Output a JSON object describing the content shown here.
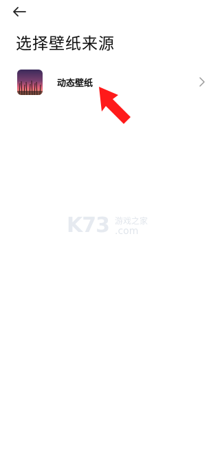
{
  "header": {
    "back_icon": "arrow-left-icon"
  },
  "page_title": "选择壁纸来源",
  "sources": [
    {
      "label": "动态壁纸",
      "thumbnail": "sunset-grass-thumbnail",
      "chevron_icon": "chevron-right-icon"
    }
  ],
  "annotation": {
    "arrow_color": "#ff1a1a"
  },
  "watermark": {
    "brand": "K73",
    "sub": "游戏之家",
    "domain": ".com"
  }
}
